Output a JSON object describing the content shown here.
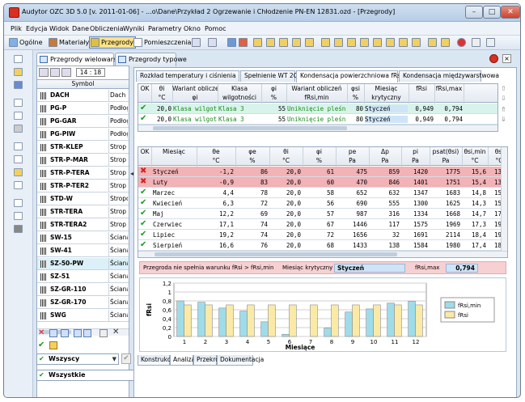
{
  "window": {
    "title": "Audytor OZC 3D 5.0  [v. 2011-01-06]  - ...o\\Dane\\Przykład 2 Ogrzewanie i Chłodzenie PN-EN 12831.ozd - [Przegrody]"
  },
  "menu": [
    "Plik",
    "Edycja",
    "Widok",
    "Dane",
    "Obliczenia",
    "Wyniki",
    "Parametry",
    "Okno",
    "Pomoc"
  ],
  "toolbar": {
    "ogolne": "Ogólne",
    "materialy": "Materiały",
    "przegrody": "Przegrody",
    "pomieszczenia": "Pomieszczenia"
  },
  "tabs": {
    "multi": "Przegrody wielowarstwowe",
    "typowe": "Przegrody typowe"
  },
  "left": {
    "time": "14 : 18",
    "symbol_header": "Symbol",
    "rows": [
      {
        "code": "DACH",
        "desc": "Dach"
      },
      {
        "code": "PG-P",
        "desc": "Podłoga"
      },
      {
        "code": "PG-GAR",
        "desc": "Podłoga"
      },
      {
        "code": "PG-PIW",
        "desc": "Podłoga"
      },
      {
        "code": "STR-KLEP",
        "desc": "Strop na"
      },
      {
        "code": "STR-P-MAR",
        "desc": "Strop na"
      },
      {
        "code": "STR-P-TERA",
        "desc": "Strop na"
      },
      {
        "code": "STR-P-TER2",
        "desc": "Strop na"
      },
      {
        "code": "STD-W",
        "desc": "Stropod"
      },
      {
        "code": "STR-TERA",
        "desc": "Strop na"
      },
      {
        "code": "STR-TERA2",
        "desc": "Strop na"
      },
      {
        "code": "SW-15",
        "desc": "Ściana w"
      },
      {
        "code": "SW-41",
        "desc": "Ściana w"
      },
      {
        "code": "SZ-50-PW",
        "desc": "Ściana z"
      },
      {
        "code": "SZ-51",
        "desc": "Ściana z"
      },
      {
        "code": "SZ-GR-110",
        "desc": "Ściana z"
      },
      {
        "code": "SZ-GR-170",
        "desc": "Ściana z"
      },
      {
        "code": "SWG",
        "desc": "Ściana w"
      }
    ],
    "filter1": "Wszyscy",
    "filter2": "Wszystkie"
  },
  "subtabs": [
    "Rozkład temperatury i ciśnienia",
    "Spełnienie WT 2008",
    "Kondensacja powierzchniowa fRsi",
    "Kondensacja międzywarstwowa"
  ],
  "top_table": {
    "headers": [
      {
        "t": "OK",
        "u": ""
      },
      {
        "t": "θi",
        "u": "°C"
      },
      {
        "t": "Wariant obliczeń",
        "u": "φi"
      },
      {
        "t": "Klasa",
        "u": "wilgotności"
      },
      {
        "t": "φi",
        "u": "%"
      },
      {
        "t": "Wariant obliczeń",
        "u": "fRsi,min"
      },
      {
        "t": "φsi",
        "u": "%"
      },
      {
        "t": "Miesiąc",
        "u": "krytyczny"
      },
      {
        "t": "fRsi",
        "u": ""
      },
      {
        "t": "fRsi,max",
        "u": ""
      }
    ],
    "rows": [
      [
        "20,0",
        "Klasa wilgotności",
        "Klasa 3",
        "55",
        "Uniknięcie pleśni",
        "80",
        "Styczeń",
        "0,949",
        "0,794"
      ],
      [
        "20,0",
        "Klasa wilgotności",
        "Klasa 3",
        "55",
        "Uniknięcie pleśni",
        "80",
        "Styczeń",
        "0,949",
        "0,794"
      ]
    ]
  },
  "month_table": {
    "headers": [
      "OK",
      "Miesiąc",
      "θe",
      "φe",
      "θi",
      "φi",
      "pe",
      "Δp",
      "pi",
      "psat(θsi)",
      "θsi,min",
      "θsi"
    ],
    "units": [
      "",
      "",
      "°C",
      "%",
      "°C",
      "%",
      "Pa",
      "Pa",
      "Pa",
      "Pa",
      "°C",
      "°C"
    ],
    "rows": [
      {
        "ok": false,
        "v": [
          "Styczeń",
          "-1,2",
          "86",
          "20,0",
          "61",
          "475",
          "859",
          "1420",
          "1775",
          "15,6",
          "13,3"
        ]
      },
      {
        "ok": false,
        "v": [
          "Luty",
          "-0,9",
          "83",
          "20,0",
          "60",
          "470",
          "846",
          "1401",
          "1751",
          "15,4",
          "13,4"
        ]
      },
      {
        "ok": true,
        "v": [
          "Marzec",
          "4,4",
          "78",
          "20,0",
          "58",
          "652",
          "632",
          "1347",
          "1683",
          "14,8",
          "15,2"
        ]
      },
      {
        "ok": true,
        "v": [
          "Kwiecień",
          "6,3",
          "72",
          "20,0",
          "56",
          "690",
          "555",
          "1300",
          "1625",
          "14,3",
          "15,7"
        ]
      },
      {
        "ok": true,
        "v": [
          "Maj",
          "12,2",
          "69",
          "20,0",
          "57",
          "987",
          "316",
          "1334",
          "1668",
          "14,7",
          "17,5"
        ]
      },
      {
        "ok": true,
        "v": [
          "Czerwiec",
          "17,1",
          "74",
          "20,0",
          "67",
          "1446",
          "117",
          "1575",
          "1969",
          "17,3",
          "19,1"
        ]
      },
      {
        "ok": true,
        "v": [
          "Lipiec",
          "19,2",
          "74",
          "20,0",
          "72",
          "1656",
          "32",
          "1691",
          "2114",
          "18,4",
          "19,7"
        ]
      },
      {
        "ok": true,
        "v": [
          "Sierpień",
          "16,6",
          "76",
          "20,0",
          "68",
          "1433",
          "138",
          "1584",
          "1980",
          "17,4",
          "18,9"
        ]
      }
    ]
  },
  "status": {
    "msg": "Przegroda nie spełnia warunku fRsi > fRsi,min",
    "crit_label": "Miesiąc krytyczny",
    "crit_value": "Styczeń",
    "fmax_label": "fRsi,max",
    "fmax_value": "0,794"
  },
  "chart_data": {
    "type": "bar",
    "categories": [
      "1",
      "2",
      "3",
      "4",
      "5",
      "6",
      "7",
      "8",
      "9",
      "10",
      "11",
      "12"
    ],
    "series": [
      {
        "name": "fRsi,min",
        "values": [
          0.8,
          0.77,
          0.64,
          0.57,
          0.33,
          0.05,
          -0.15,
          0.19,
          0.55,
          0.62,
          0.75,
          0.79
        ]
      },
      {
        "name": "fRsi",
        "values": [
          0.71,
          0.71,
          0.71,
          0.71,
          0.71,
          0.71,
          0.71,
          0.71,
          0.71,
          0.71,
          0.71,
          0.71
        ]
      }
    ],
    "xlabel": "Miesiące",
    "ylabel": "fRsi",
    "ylim": [
      0,
      1.2
    ],
    "yticks": [
      "0",
      "0,2",
      "0,4",
      "0,6",
      "0,8",
      "1",
      "1,2"
    ],
    "colors": {
      "fRsi,min": "#9fdcea",
      "fRsi": "#fbeaa6"
    },
    "legend": "right"
  },
  "bottom_tabs": [
    "Konstrukcja",
    "Analiza",
    "Przekrój",
    "Dokumentacja"
  ],
  "colors": {
    "ok": "#1a9a1a",
    "fail": "#d42020",
    "fail_row": "#f2b2b6",
    "sel_row": "#d8f4ea"
  }
}
